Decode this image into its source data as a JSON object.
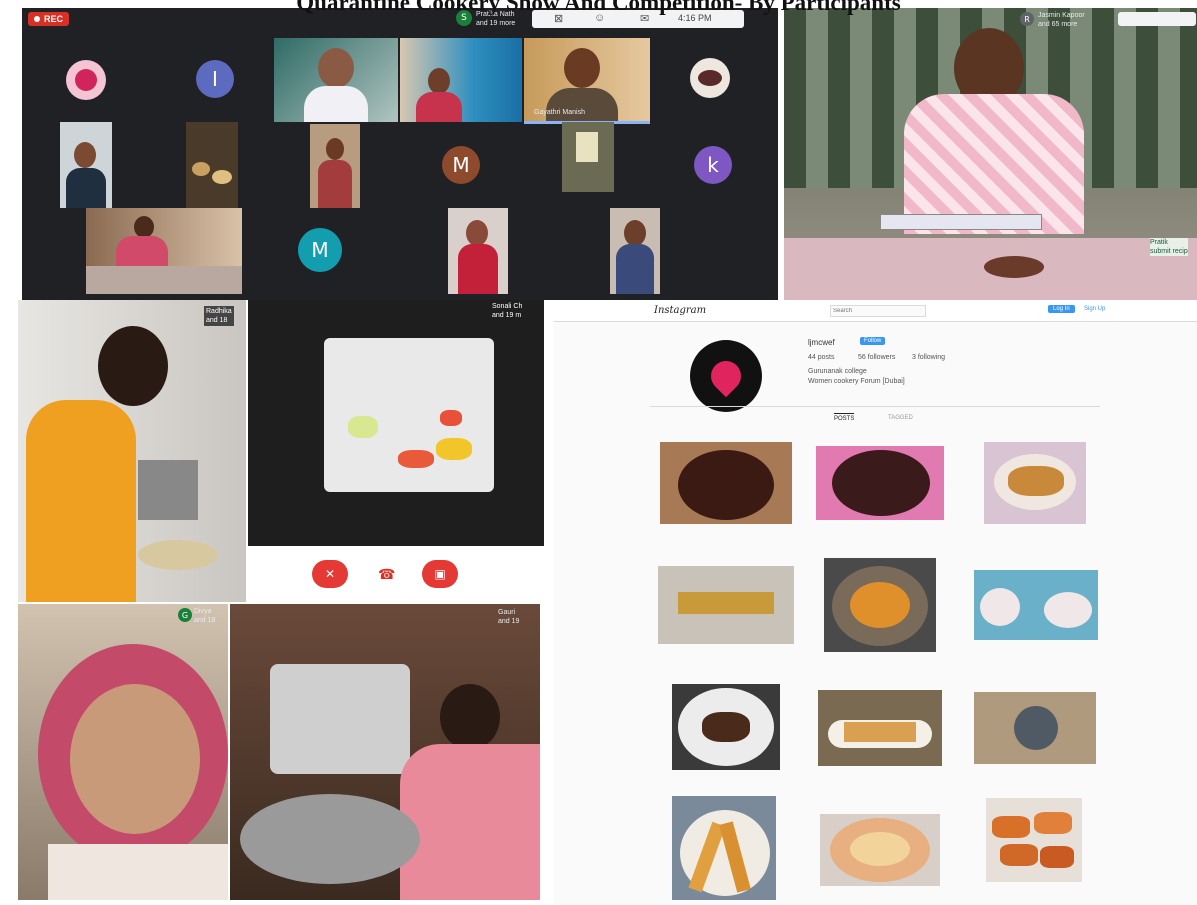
{
  "page_title": "Quarantine Cookery Show And Competition- By Participants",
  "meet_grid": {
    "rec_label": "REC",
    "presenter_avatar_letter": "S",
    "presenter_chip": "Pratika Nath\nand 19 more",
    "clock": "4:16 PM",
    "avatar_letters": [
      "I",
      "M",
      "k",
      "M"
    ],
    "caption_name": "Gayathri Manish"
  },
  "tile_2": {
    "avatar_letter": "R",
    "chip": "Jasmin Kapoor\nand 65 more",
    "side_note": "Pratik\nsubmit recip"
  },
  "tile_3": {
    "chip": "Radhika\nand 18"
  },
  "tile_4": {
    "chip": "Sonali Ch\nand 19 m"
  },
  "tile_5": {
    "avatar_letter": "G",
    "chip": "Divya\nand 18"
  },
  "tile_6": {
    "chip": "Gauri\nand 19"
  },
  "instagram": {
    "logo": "Instagram",
    "search_placeholder": "Search",
    "login_label": "Log In",
    "signup_label": "Sign Up",
    "username": "ljmcwef",
    "follow_label": "Follow",
    "stats": [
      "44 posts",
      "56 followers",
      "3 following"
    ],
    "bio_line_1": "Gurunanak college",
    "bio_line_2": "Women cookery Forum [Dubai]",
    "tab_posts": "POSTS",
    "tab_tagged": "TAGGED"
  },
  "colors": {
    "meet_bg": "#202124",
    "rec_red": "#d93025",
    "instagram_follow_blue": "#3897f0",
    "call_red": "#e53935",
    "avatar_purple": "#7e57c2",
    "avatar_teal": "#129eaf",
    "avatar_brown": "#8d4a2d"
  }
}
